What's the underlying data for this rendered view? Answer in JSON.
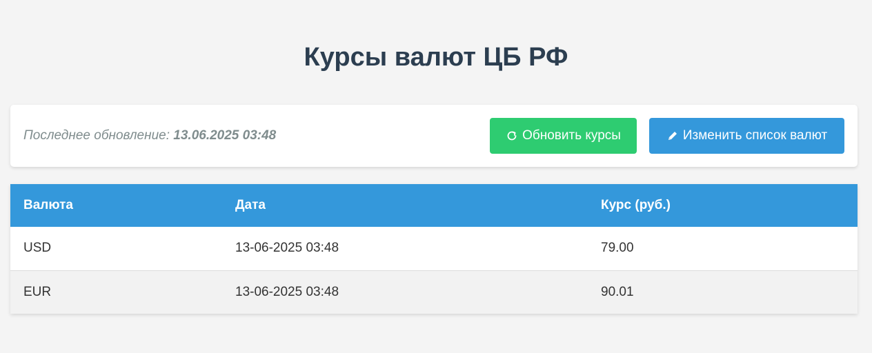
{
  "header": {
    "title": "Курсы валют ЦБ РФ"
  },
  "info": {
    "last_update_label": "Последнее обновление:",
    "last_update_value": "13.06.2025 03:48"
  },
  "buttons": {
    "refresh_label": "Обновить курсы",
    "refresh_icon": "refresh-icon",
    "edit_label": "Изменить список валют",
    "edit_icon": "pencil-icon"
  },
  "colors": {
    "title": "#2c3e50",
    "refresh_button": "#2ecc71",
    "edit_button": "#3498db",
    "table_header": "#3498db"
  },
  "table": {
    "columns": [
      "Валюта",
      "Дата",
      "Курс (руб.)"
    ],
    "rows": [
      [
        "USD",
        "13-06-2025 03:48",
        "79.00"
      ],
      [
        "EUR",
        "13-06-2025 03:48",
        "90.01"
      ]
    ]
  }
}
